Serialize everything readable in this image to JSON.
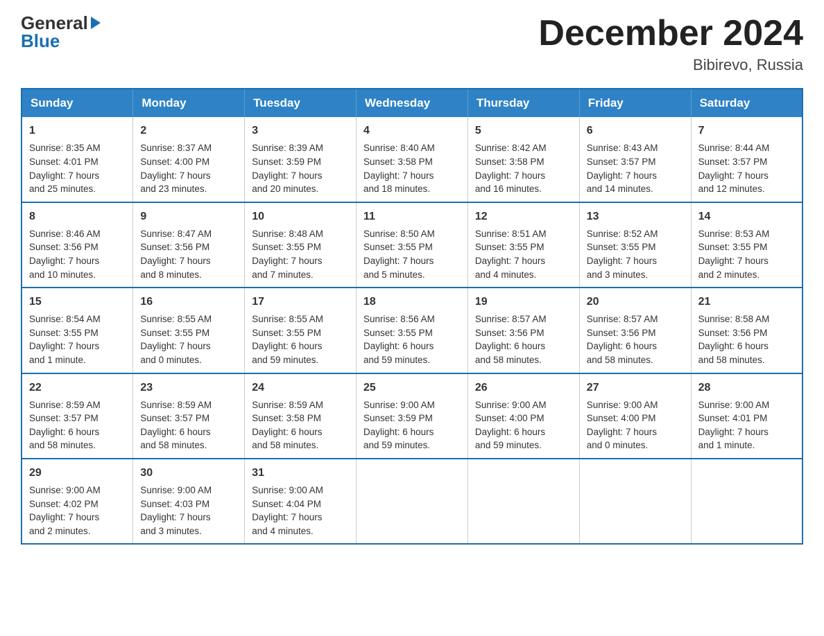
{
  "logo": {
    "general": "General",
    "blue": "Blue"
  },
  "header": {
    "month_title": "December 2024",
    "location": "Bibirevo, Russia"
  },
  "weekdays": [
    "Sunday",
    "Monday",
    "Tuesday",
    "Wednesday",
    "Thursday",
    "Friday",
    "Saturday"
  ],
  "weeks": [
    [
      {
        "day": 1,
        "lines": [
          "Sunrise: 8:35 AM",
          "Sunset: 4:01 PM",
          "Daylight: 7 hours",
          "and 25 minutes."
        ]
      },
      {
        "day": 2,
        "lines": [
          "Sunrise: 8:37 AM",
          "Sunset: 4:00 PM",
          "Daylight: 7 hours",
          "and 23 minutes."
        ]
      },
      {
        "day": 3,
        "lines": [
          "Sunrise: 8:39 AM",
          "Sunset: 3:59 PM",
          "Daylight: 7 hours",
          "and 20 minutes."
        ]
      },
      {
        "day": 4,
        "lines": [
          "Sunrise: 8:40 AM",
          "Sunset: 3:58 PM",
          "Daylight: 7 hours",
          "and 18 minutes."
        ]
      },
      {
        "day": 5,
        "lines": [
          "Sunrise: 8:42 AM",
          "Sunset: 3:58 PM",
          "Daylight: 7 hours",
          "and 16 minutes."
        ]
      },
      {
        "day": 6,
        "lines": [
          "Sunrise: 8:43 AM",
          "Sunset: 3:57 PM",
          "Daylight: 7 hours",
          "and 14 minutes."
        ]
      },
      {
        "day": 7,
        "lines": [
          "Sunrise: 8:44 AM",
          "Sunset: 3:57 PM",
          "Daylight: 7 hours",
          "and 12 minutes."
        ]
      }
    ],
    [
      {
        "day": 8,
        "lines": [
          "Sunrise: 8:46 AM",
          "Sunset: 3:56 PM",
          "Daylight: 7 hours",
          "and 10 minutes."
        ]
      },
      {
        "day": 9,
        "lines": [
          "Sunrise: 8:47 AM",
          "Sunset: 3:56 PM",
          "Daylight: 7 hours",
          "and 8 minutes."
        ]
      },
      {
        "day": 10,
        "lines": [
          "Sunrise: 8:48 AM",
          "Sunset: 3:55 PM",
          "Daylight: 7 hours",
          "and 7 minutes."
        ]
      },
      {
        "day": 11,
        "lines": [
          "Sunrise: 8:50 AM",
          "Sunset: 3:55 PM",
          "Daylight: 7 hours",
          "and 5 minutes."
        ]
      },
      {
        "day": 12,
        "lines": [
          "Sunrise: 8:51 AM",
          "Sunset: 3:55 PM",
          "Daylight: 7 hours",
          "and 4 minutes."
        ]
      },
      {
        "day": 13,
        "lines": [
          "Sunrise: 8:52 AM",
          "Sunset: 3:55 PM",
          "Daylight: 7 hours",
          "and 3 minutes."
        ]
      },
      {
        "day": 14,
        "lines": [
          "Sunrise: 8:53 AM",
          "Sunset: 3:55 PM",
          "Daylight: 7 hours",
          "and 2 minutes."
        ]
      }
    ],
    [
      {
        "day": 15,
        "lines": [
          "Sunrise: 8:54 AM",
          "Sunset: 3:55 PM",
          "Daylight: 7 hours",
          "and 1 minute."
        ]
      },
      {
        "day": 16,
        "lines": [
          "Sunrise: 8:55 AM",
          "Sunset: 3:55 PM",
          "Daylight: 7 hours",
          "and 0 minutes."
        ]
      },
      {
        "day": 17,
        "lines": [
          "Sunrise: 8:55 AM",
          "Sunset: 3:55 PM",
          "Daylight: 6 hours",
          "and 59 minutes."
        ]
      },
      {
        "day": 18,
        "lines": [
          "Sunrise: 8:56 AM",
          "Sunset: 3:55 PM",
          "Daylight: 6 hours",
          "and 59 minutes."
        ]
      },
      {
        "day": 19,
        "lines": [
          "Sunrise: 8:57 AM",
          "Sunset: 3:56 PM",
          "Daylight: 6 hours",
          "and 58 minutes."
        ]
      },
      {
        "day": 20,
        "lines": [
          "Sunrise: 8:57 AM",
          "Sunset: 3:56 PM",
          "Daylight: 6 hours",
          "and 58 minutes."
        ]
      },
      {
        "day": 21,
        "lines": [
          "Sunrise: 8:58 AM",
          "Sunset: 3:56 PM",
          "Daylight: 6 hours",
          "and 58 minutes."
        ]
      }
    ],
    [
      {
        "day": 22,
        "lines": [
          "Sunrise: 8:59 AM",
          "Sunset: 3:57 PM",
          "Daylight: 6 hours",
          "and 58 minutes."
        ]
      },
      {
        "day": 23,
        "lines": [
          "Sunrise: 8:59 AM",
          "Sunset: 3:57 PM",
          "Daylight: 6 hours",
          "and 58 minutes."
        ]
      },
      {
        "day": 24,
        "lines": [
          "Sunrise: 8:59 AM",
          "Sunset: 3:58 PM",
          "Daylight: 6 hours",
          "and 58 minutes."
        ]
      },
      {
        "day": 25,
        "lines": [
          "Sunrise: 9:00 AM",
          "Sunset: 3:59 PM",
          "Daylight: 6 hours",
          "and 59 minutes."
        ]
      },
      {
        "day": 26,
        "lines": [
          "Sunrise: 9:00 AM",
          "Sunset: 4:00 PM",
          "Daylight: 6 hours",
          "and 59 minutes."
        ]
      },
      {
        "day": 27,
        "lines": [
          "Sunrise: 9:00 AM",
          "Sunset: 4:00 PM",
          "Daylight: 7 hours",
          "and 0 minutes."
        ]
      },
      {
        "day": 28,
        "lines": [
          "Sunrise: 9:00 AM",
          "Sunset: 4:01 PM",
          "Daylight: 7 hours",
          "and 1 minute."
        ]
      }
    ],
    [
      {
        "day": 29,
        "lines": [
          "Sunrise: 9:00 AM",
          "Sunset: 4:02 PM",
          "Daylight: 7 hours",
          "and 2 minutes."
        ]
      },
      {
        "day": 30,
        "lines": [
          "Sunrise: 9:00 AM",
          "Sunset: 4:03 PM",
          "Daylight: 7 hours",
          "and 3 minutes."
        ]
      },
      {
        "day": 31,
        "lines": [
          "Sunrise: 9:00 AM",
          "Sunset: 4:04 PM",
          "Daylight: 7 hours",
          "and 4 minutes."
        ]
      },
      null,
      null,
      null,
      null
    ]
  ]
}
